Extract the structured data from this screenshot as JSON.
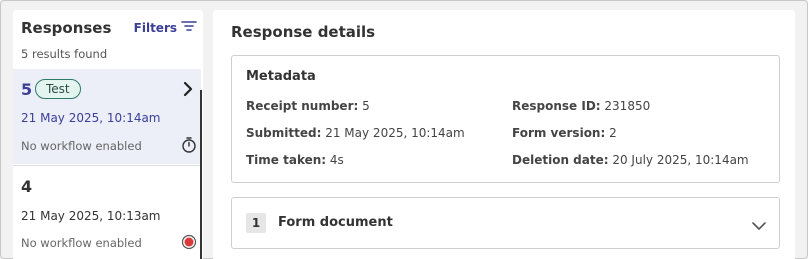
{
  "responses": {
    "title": "Responses",
    "filters_label": "Filters",
    "results_text": "5 results found",
    "items": [
      {
        "number": "5",
        "badge": "Test",
        "date": "21 May 2025, 10:14am",
        "workflow": "No workflow enabled"
      },
      {
        "number": "4",
        "date": "21 May 2025, 10:13am",
        "workflow": "No workflow enabled"
      }
    ]
  },
  "details": {
    "title": "Response details",
    "metadata": {
      "title": "Metadata",
      "receipt_label": "Receipt number:",
      "receipt_value": " 5",
      "submitted_label": "Submitted:",
      "submitted_value": " 21 May 2025, 10:14am",
      "time_label": "Time taken:",
      "time_value": " 4s",
      "response_id_label": "Response ID:",
      "response_id_value": " 231850",
      "form_version_label": "Form version:",
      "form_version_value": " 2",
      "deletion_label": "Deletion date:",
      "deletion_value": " 20 July 2025, 10:14am"
    },
    "document": {
      "number": "1",
      "title": "Form document"
    }
  },
  "icons": [
    "filter-icon",
    "chevron-right-icon",
    "timer-icon",
    "record-icon",
    "chevron-down-icon"
  ],
  "colors": {
    "accent": "#3b3f98",
    "badge_border": "#2d7a67",
    "badge_bg": "#e4f4ef",
    "selected_bg": "#eceef8",
    "record_red": "#d93a3a"
  }
}
